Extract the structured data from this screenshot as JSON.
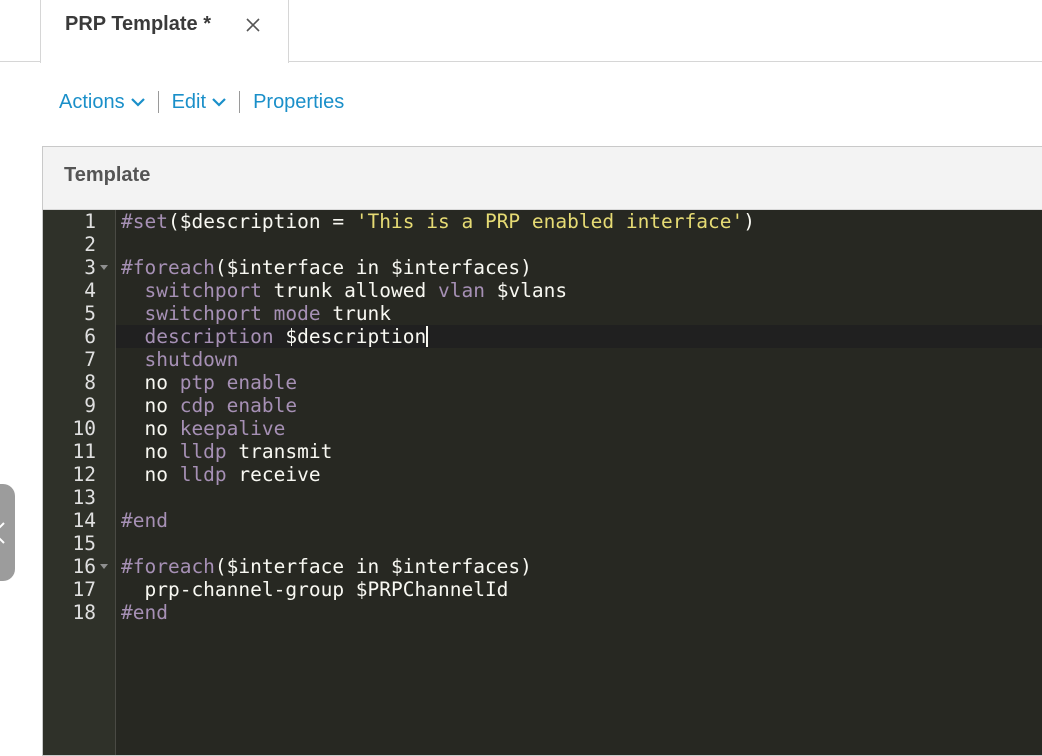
{
  "tab": {
    "title": "PRP Template *",
    "close_icon": "close-icon"
  },
  "toolbar": {
    "actions_label": "Actions",
    "edit_label": "Edit",
    "properties_label": "Properties",
    "accent_color": "#1a8fc9"
  },
  "panel": {
    "title": "Template"
  },
  "editor": {
    "theme_bg": "#272822",
    "active_line": 6,
    "lines": [
      {
        "n": "1",
        "fold": false,
        "segs": [
          {
            "t": "#set",
            "c": "dir"
          },
          {
            "t": "($description = ",
            "c": "txt"
          },
          {
            "t": "'This is a PRP enabled interface'",
            "c": "str"
          },
          {
            "t": ")",
            "c": "txt"
          }
        ]
      },
      {
        "n": "2",
        "fold": false,
        "segs": []
      },
      {
        "n": "3",
        "fold": true,
        "segs": [
          {
            "t": "#foreach",
            "c": "dir"
          },
          {
            "t": "($interface in $interfaces)",
            "c": "txt"
          }
        ]
      },
      {
        "n": "4",
        "fold": false,
        "segs": [
          {
            "t": "  ",
            "c": "txt"
          },
          {
            "t": "switchport",
            "c": "kw"
          },
          {
            "t": " trunk allowed ",
            "c": "txt"
          },
          {
            "t": "vlan",
            "c": "kw"
          },
          {
            "t": " $vlans",
            "c": "txt"
          }
        ]
      },
      {
        "n": "5",
        "fold": false,
        "segs": [
          {
            "t": "  ",
            "c": "txt"
          },
          {
            "t": "switchport mode",
            "c": "kw"
          },
          {
            "t": " trunk",
            "c": "txt"
          }
        ]
      },
      {
        "n": "6",
        "fold": false,
        "segs": [
          {
            "t": "  ",
            "c": "txt"
          },
          {
            "t": "description",
            "c": "kw"
          },
          {
            "t": " $description",
            "c": "txt"
          }
        ],
        "cursor": true
      },
      {
        "n": "7",
        "fold": false,
        "segs": [
          {
            "t": "  ",
            "c": "txt"
          },
          {
            "t": "shutdown",
            "c": "kw"
          }
        ]
      },
      {
        "n": "8",
        "fold": false,
        "segs": [
          {
            "t": "  no ",
            "c": "txt"
          },
          {
            "t": "ptp enable",
            "c": "kw"
          }
        ]
      },
      {
        "n": "9",
        "fold": false,
        "segs": [
          {
            "t": "  no ",
            "c": "txt"
          },
          {
            "t": "cdp enable",
            "c": "kw"
          }
        ]
      },
      {
        "n": "10",
        "fold": false,
        "segs": [
          {
            "t": "  no ",
            "c": "txt"
          },
          {
            "t": "keepalive",
            "c": "kw"
          }
        ]
      },
      {
        "n": "11",
        "fold": false,
        "segs": [
          {
            "t": "  no ",
            "c": "txt"
          },
          {
            "t": "lldp",
            "c": "kw"
          },
          {
            "t": " transmit",
            "c": "txt"
          }
        ]
      },
      {
        "n": "12",
        "fold": false,
        "segs": [
          {
            "t": "  no ",
            "c": "txt"
          },
          {
            "t": "lldp",
            "c": "kw"
          },
          {
            "t": " receive",
            "c": "txt"
          }
        ]
      },
      {
        "n": "13",
        "fold": false,
        "segs": []
      },
      {
        "n": "14",
        "fold": false,
        "segs": [
          {
            "t": "#end",
            "c": "dir"
          }
        ]
      },
      {
        "n": "15",
        "fold": false,
        "segs": []
      },
      {
        "n": "16",
        "fold": true,
        "segs": [
          {
            "t": "#foreach",
            "c": "dir"
          },
          {
            "t": "($interface in $interfaces)",
            "c": "txt"
          }
        ]
      },
      {
        "n": "17",
        "fold": false,
        "segs": [
          {
            "t": "  prp-channel-group $PRPChannelId",
            "c": "txt"
          }
        ]
      },
      {
        "n": "18",
        "fold": false,
        "segs": [
          {
            "t": "#end",
            "c": "dir"
          }
        ]
      }
    ]
  }
}
